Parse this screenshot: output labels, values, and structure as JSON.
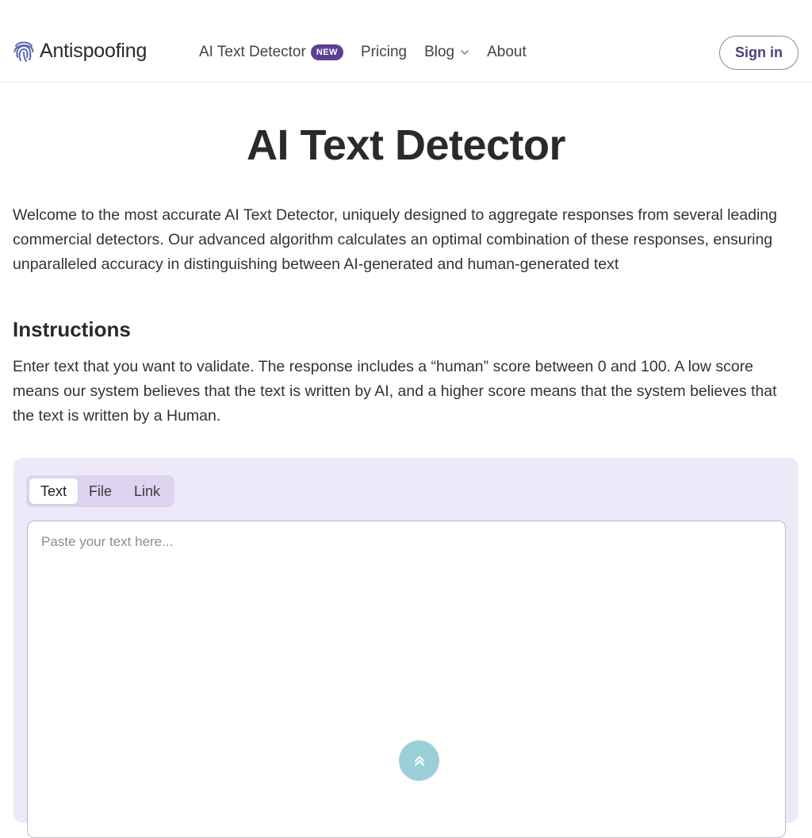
{
  "header": {
    "brand": {
      "name": "Antispoofing",
      "logo_icon": "fingerprint-icon",
      "logo_color": "#5a67b0"
    },
    "nav": [
      {
        "label": "AI Text Detector",
        "badge": "NEW"
      },
      {
        "label": "Pricing"
      },
      {
        "label": "Blog",
        "icon": "chevron-down-icon"
      },
      {
        "label": "About"
      }
    ],
    "signin_label": "Sign in"
  },
  "main": {
    "title": "AI Text Detector",
    "intro": "Welcome to the most accurate AI Text Detector, uniquely designed to aggregate responses from several leading commercial detectors. Our advanced algorithm calculates an optimal combination of these responses, ensuring unparalleled accuracy in distinguishing between AI-generated and human-generated text",
    "instructions_heading": "Instructions",
    "instructions_text": "Enter text that you want to validate. The response includes a “human” score between 0 and 100. A low score means our system believes that the text is written by AI, and a higher score means that the system believes that the text is written by a Human."
  },
  "detector": {
    "tabs": [
      {
        "label": "Text",
        "active": true
      },
      {
        "label": "File",
        "active": false
      },
      {
        "label": "Link",
        "active": false
      }
    ],
    "input": {
      "placeholder": "Paste your text here...",
      "value": ""
    },
    "scroll_button_icon": "double-chevron-up-icon"
  },
  "colors": {
    "accent": "#5b3f95",
    "panel_bg": "#eee9f8",
    "tabs_bg": "#ddd4ef",
    "scroll_button": "#9bd0d9"
  }
}
